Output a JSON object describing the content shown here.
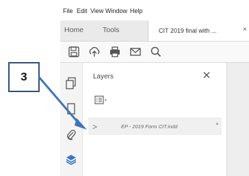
{
  "menu": {
    "file": "File",
    "edit": "Edit",
    "view": "View",
    "window": "Window",
    "help": "Help"
  },
  "tabs": {
    "home": "Home",
    "tools": "Tools",
    "document": "CIT 2019 final with ...",
    "close": "×"
  },
  "toolbar": {
    "icons": [
      "save-icon",
      "upload-icon",
      "print-icon",
      "email-icon",
      "zoom-icon"
    ]
  },
  "left_rail": {
    "icons": [
      "pages-icon",
      "bookmarks-icon",
      "attachments-icon",
      "layers-icon"
    ]
  },
  "layers_panel": {
    "title": "Layers",
    "close": "×",
    "layer_row": {
      "expand": ">",
      "name": "EP - 2019 Form CIT.indd"
    }
  },
  "callout": {
    "number": "3"
  },
  "colors": {
    "accent_blue": "#2f6db3",
    "layers_icon": "#3a76c4",
    "callout_border": "#2e4e7a"
  }
}
